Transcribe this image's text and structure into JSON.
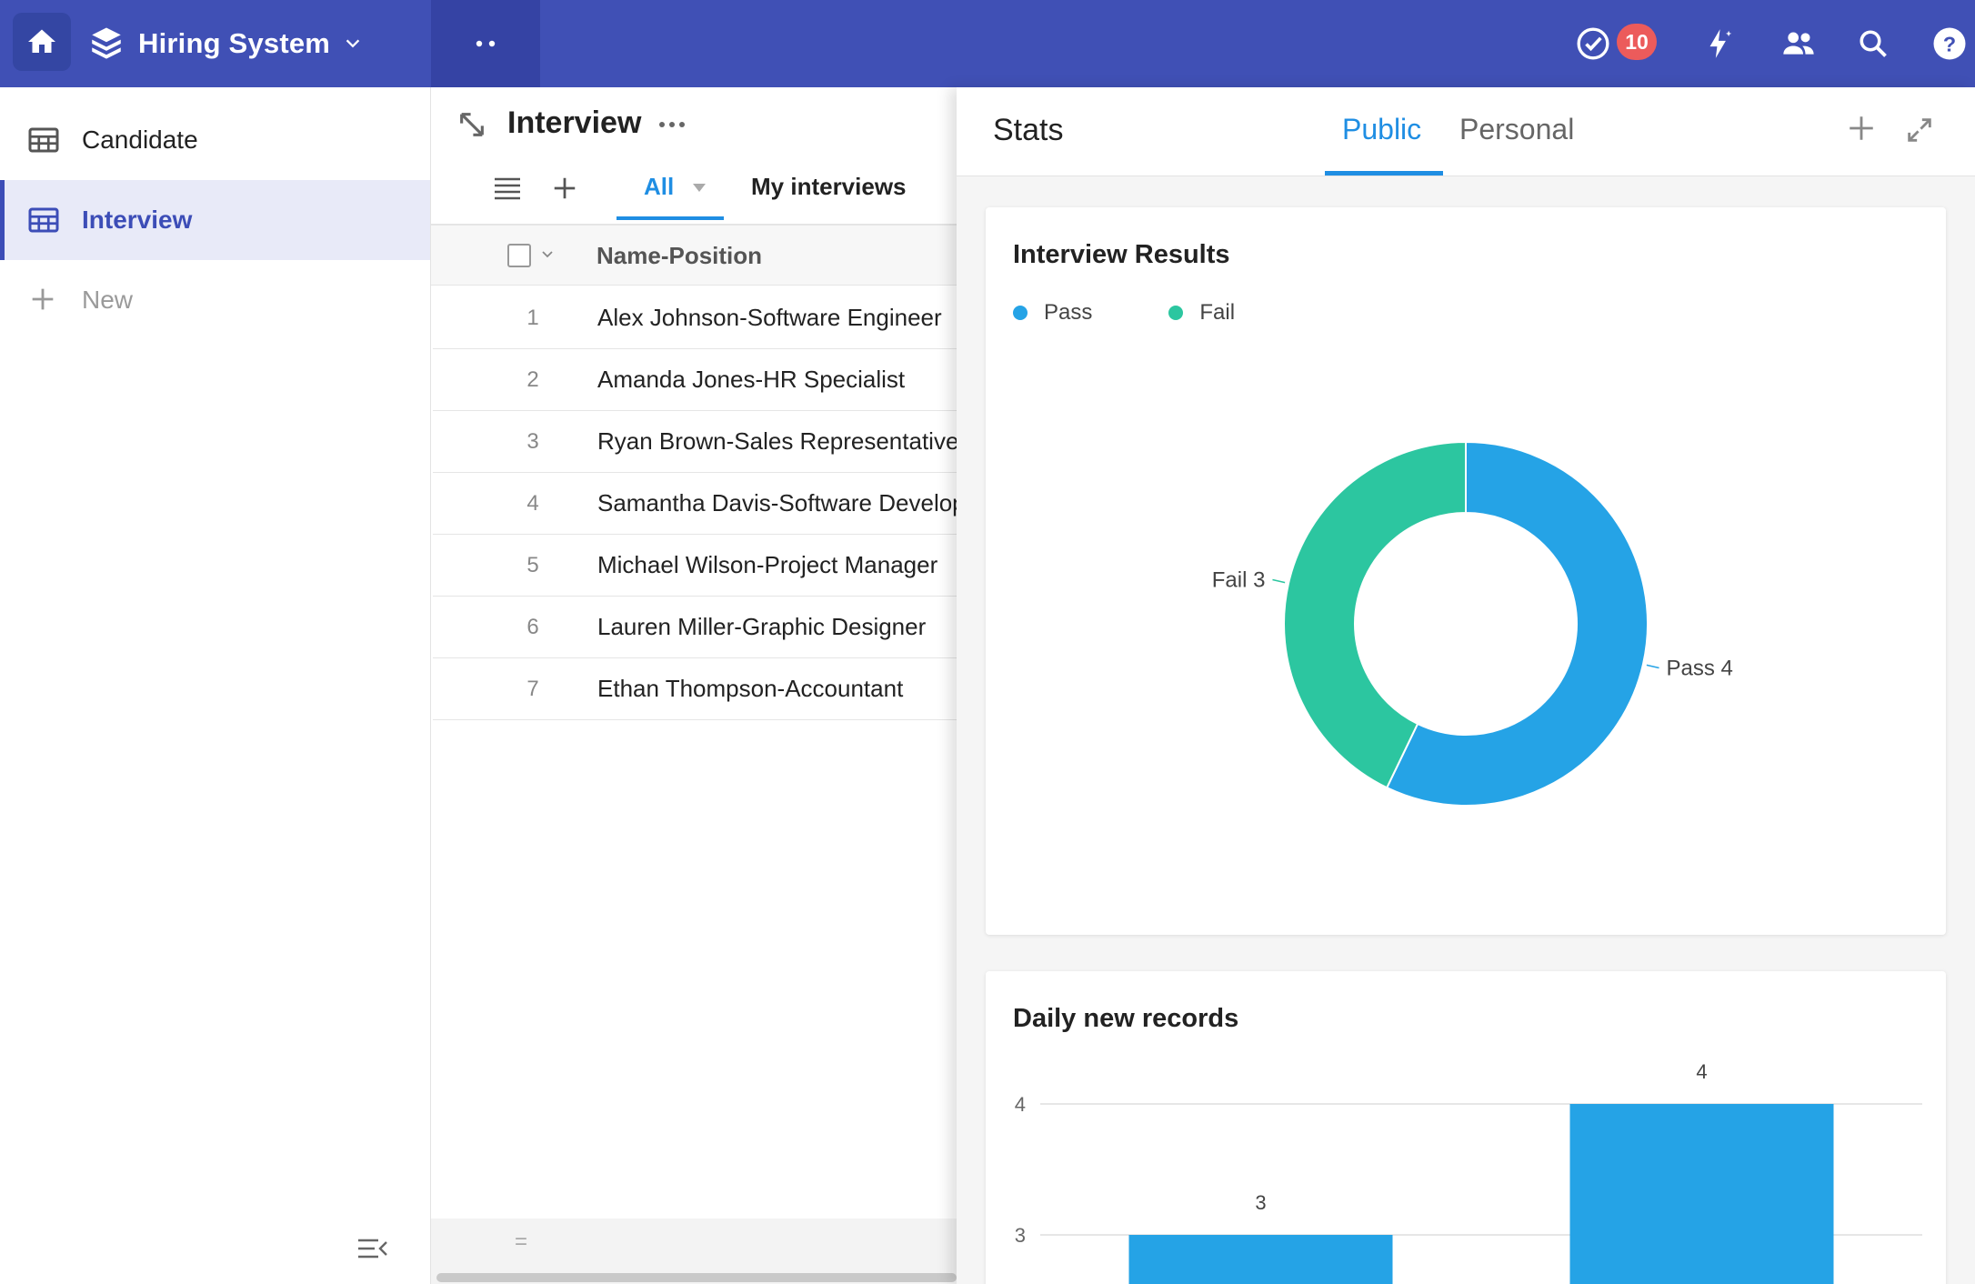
{
  "header": {
    "app_title": "Hiring System",
    "notification_count": "10"
  },
  "sidebar": {
    "items": [
      {
        "label": "Candidate"
      },
      {
        "label": "Interview"
      }
    ],
    "new_label": "New"
  },
  "view": {
    "title": "Interview",
    "tabs": [
      {
        "label": "All"
      },
      {
        "label": "My interviews"
      }
    ],
    "column_header": "Name-Position",
    "rows": [
      {
        "num": "1",
        "name": "Alex Johnson-Software Engineer"
      },
      {
        "num": "2",
        "name": "Amanda Jones-HR Specialist"
      },
      {
        "num": "3",
        "name": "Ryan Brown-Sales Representative"
      },
      {
        "num": "4",
        "name": "Samantha Davis-Software Developer"
      },
      {
        "num": "5",
        "name": "Michael Wilson-Project Manager"
      },
      {
        "num": "6",
        "name": "Lauren Miller-Graphic Designer"
      },
      {
        "num": "7",
        "name": "Ethan Thompson-Accountant"
      }
    ],
    "footer_symbol": "="
  },
  "stats": {
    "title": "Stats",
    "tabs": [
      {
        "label": "Public"
      },
      {
        "label": "Personal"
      }
    ]
  },
  "colors": {
    "topbar": "#4050b5",
    "accent": "#1f8ee3",
    "pass": "#25a3e6",
    "fail": "#2cc6a0",
    "badge": "#ec5b5b"
  },
  "chart_data": [
    {
      "type": "pie",
      "style": "donut",
      "title": "Interview Results",
      "labels": [
        "Pass",
        "Fail"
      ],
      "values": [
        4,
        3
      ],
      "legend": "top-left"
    },
    {
      "type": "bar",
      "title": "Daily new records",
      "categories": [
        "",
        ""
      ],
      "values": [
        3,
        4
      ],
      "y_ticks": [
        3,
        4
      ],
      "grid": true
    }
  ]
}
